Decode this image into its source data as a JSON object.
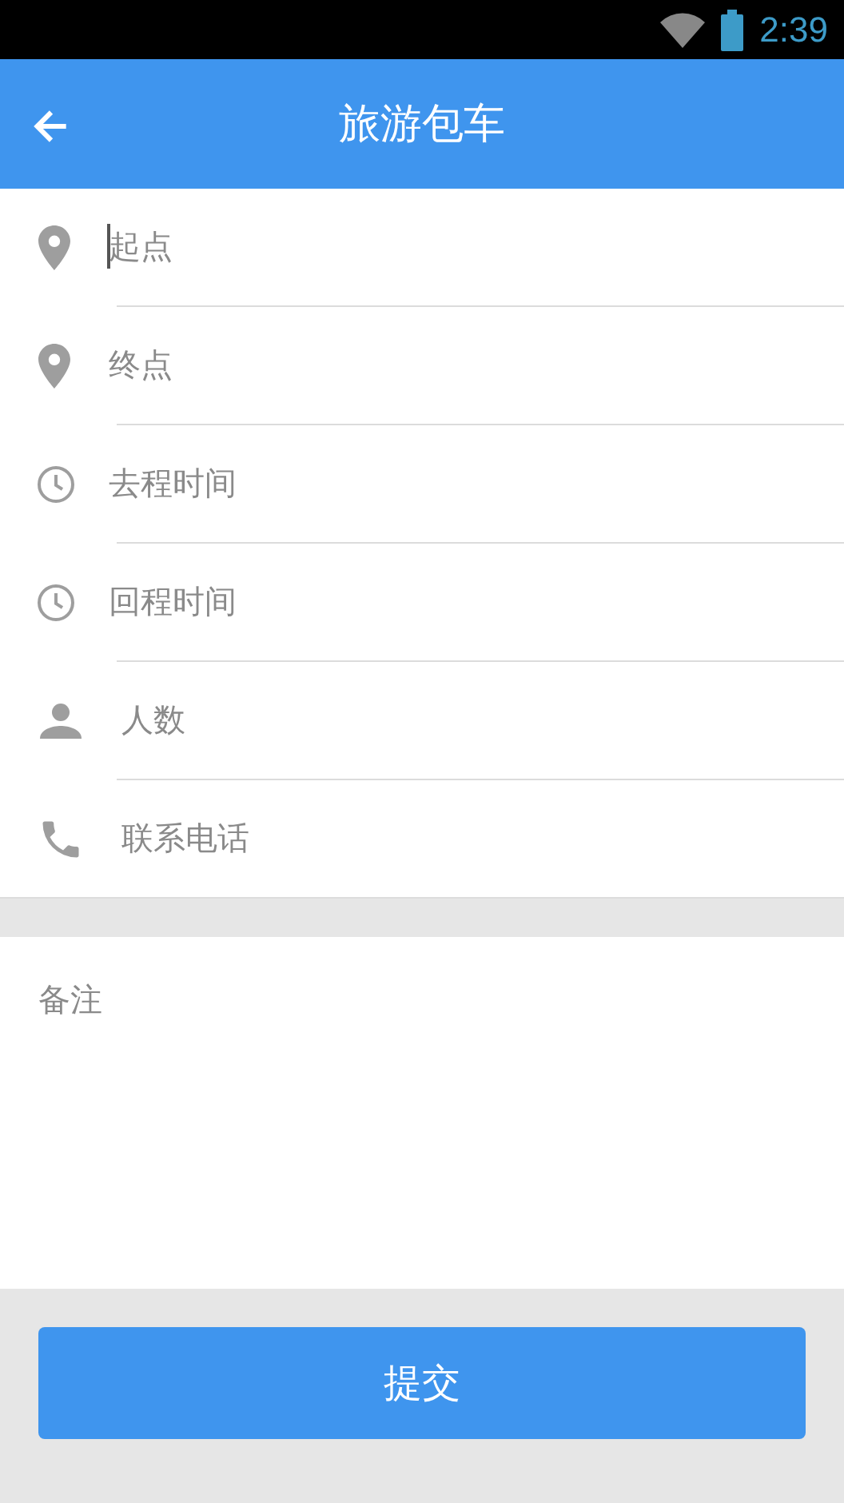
{
  "status_bar": {
    "time": "2:39"
  },
  "header": {
    "title": "旅游包车"
  },
  "fields": [
    {
      "kind": "pin",
      "placeholder": "起点",
      "focused": true
    },
    {
      "kind": "pin",
      "placeholder": "终点",
      "focused": false
    },
    {
      "kind": "clock",
      "placeholder": "去程时间",
      "focused": false
    },
    {
      "kind": "clock",
      "placeholder": "回程时间",
      "focused": false
    },
    {
      "kind": "person",
      "placeholder": "人数",
      "focused": false
    },
    {
      "kind": "phone",
      "placeholder": "联系电话",
      "focused": false
    }
  ],
  "remarks": {
    "placeholder": "备注"
  },
  "submit_button": "提交"
}
